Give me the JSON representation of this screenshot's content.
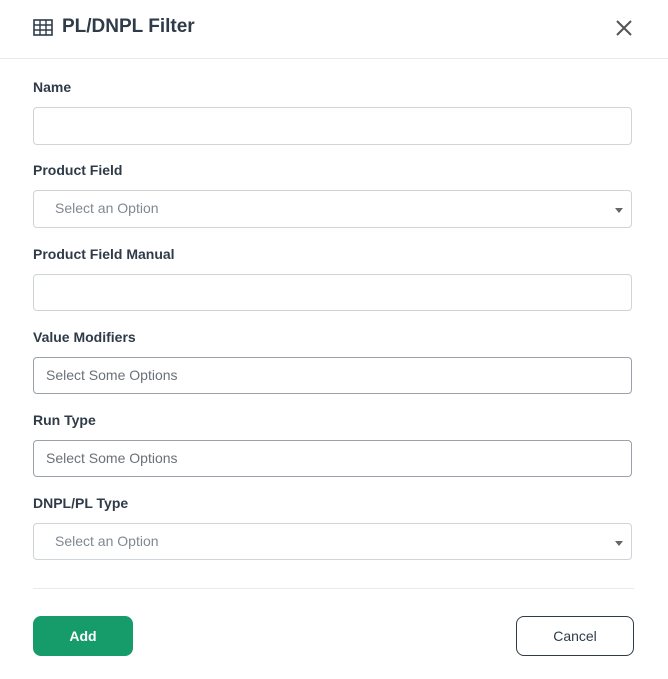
{
  "header": {
    "title": "PL/DNPL Filter",
    "icon": "table-grid-icon",
    "close_icon": "close-icon"
  },
  "form": {
    "name": {
      "label": "Name",
      "value": ""
    },
    "product_field": {
      "label": "Product Field",
      "placeholder": "Select an Option"
    },
    "product_field_manual": {
      "label": "Product Field Manual",
      "value": ""
    },
    "value_modifiers": {
      "label": "Value Modifiers",
      "placeholder": "Select Some Options"
    },
    "run_type": {
      "label": "Run Type",
      "placeholder": "Select Some Options"
    },
    "dnpl_pl_type": {
      "label": "DNPL/PL Type",
      "placeholder": "Select an Option"
    }
  },
  "footer": {
    "add_label": "Add",
    "cancel_label": "Cancel"
  },
  "colors": {
    "primary": "#169b6b",
    "text": "#2f3b48"
  }
}
